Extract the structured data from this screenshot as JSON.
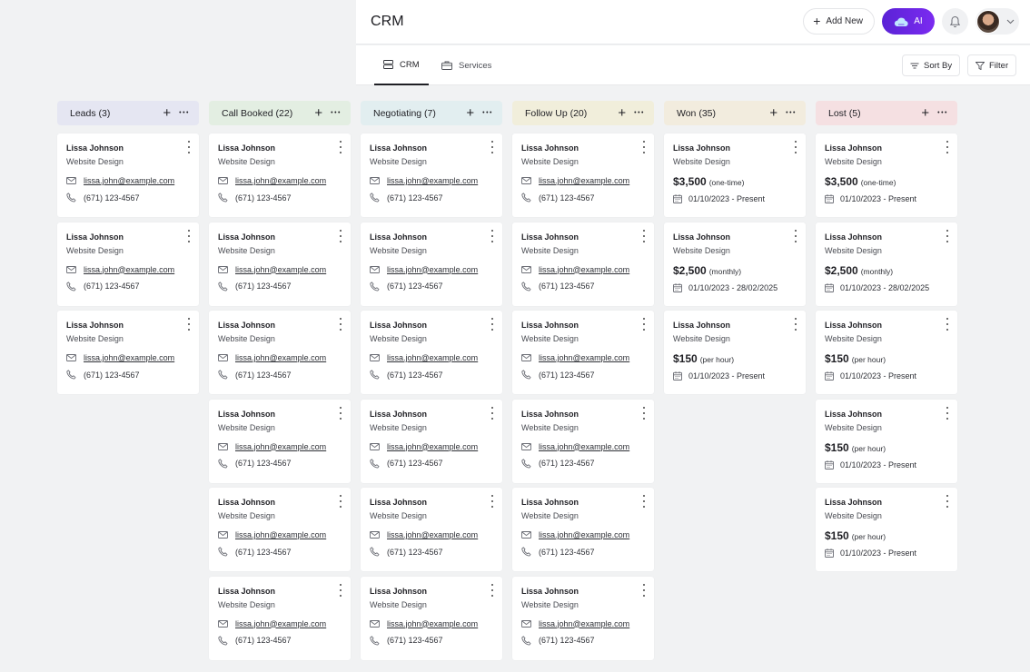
{
  "header": {
    "title": "CRM",
    "add_new_label": "Add New",
    "ai_label": "AI"
  },
  "tabs": [
    {
      "label": "CRM",
      "active": true,
      "icon": "stack-icon"
    },
    {
      "label": "Services",
      "active": false,
      "icon": "briefcase-icon"
    }
  ],
  "toolbar": {
    "sort_label": "Sort By",
    "filter_label": "Filter"
  },
  "colors": {
    "leads": "#e5e6f2",
    "call_booked": "#e3eee2",
    "negotiating": "#e2eef0",
    "follow_up": "#f1eedb",
    "won": "#f2ecde",
    "lost": "#f5e0e2",
    "ai_button": "#6a27e6"
  },
  "columns": [
    {
      "key": "leads",
      "title": "Leads (3)",
      "cards": [
        {
          "name": "Lissa Johnson",
          "service": "Website Design",
          "email": "lissa.john@example.com",
          "phone": "(671) 123-4567"
        },
        {
          "name": "Lissa Johnson",
          "service": "Website Design",
          "email": "lissa.john@example.com",
          "phone": "(671) 123-4567"
        },
        {
          "name": "Lissa Johnson",
          "service": "Website Design",
          "email": "lissa.john@example.com",
          "phone": "(671) 123-4567"
        }
      ]
    },
    {
      "key": "call_booked",
      "title": "Call Booked (22)",
      "cards": [
        {
          "name": "Lissa Johnson",
          "service": "Website Design",
          "email": "lissa.john@example.com",
          "phone": "(671) 123-4567"
        },
        {
          "name": "Lissa Johnson",
          "service": "Website Design",
          "email": "lissa.john@example.com",
          "phone": "(671) 123-4567"
        },
        {
          "name": "Lissa Johnson",
          "service": "Website Design",
          "email": "lissa.john@example.com",
          "phone": "(671) 123-4567"
        },
        {
          "name": "Lissa Johnson",
          "service": "Website Design",
          "email": "lissa.john@example.com",
          "phone": "(671) 123-4567"
        },
        {
          "name": "Lissa Johnson",
          "service": "Website Design",
          "email": "lissa.john@example.com",
          "phone": "(671) 123-4567"
        },
        {
          "name": "Lissa Johnson",
          "service": "Website Design",
          "email": "lissa.john@example.com",
          "phone": "(671) 123-4567"
        }
      ]
    },
    {
      "key": "negotiating",
      "title": "Negotiating (7)",
      "cards": [
        {
          "name": "Lissa Johnson",
          "service": "Website Design",
          "email": "lissa.john@example.com",
          "phone": "(671) 123-4567"
        },
        {
          "name": "Lissa Johnson",
          "service": "Website Design",
          "email": "lissa.john@example.com",
          "phone": "(671) 123-4567"
        },
        {
          "name": "Lissa Johnson",
          "service": "Website Design",
          "email": "lissa.john@example.com",
          "phone": "(671) 123-4567"
        },
        {
          "name": "Lissa Johnson",
          "service": "Website Design",
          "email": "lissa.john@example.com",
          "phone": "(671) 123-4567"
        },
        {
          "name": "Lissa Johnson",
          "service": "Website Design",
          "email": "lissa.john@example.com",
          "phone": "(671) 123-4567"
        },
        {
          "name": "Lissa Johnson",
          "service": "Website Design",
          "email": "lissa.john@example.com",
          "phone": "(671) 123-4567"
        }
      ]
    },
    {
      "key": "follow_up",
      "title": "Follow Up (20)",
      "cards": [
        {
          "name": "Lissa Johnson",
          "service": "Website Design",
          "email": "lissa.john@example.com",
          "phone": "(671) 123-4567"
        },
        {
          "name": "Lissa Johnson",
          "service": "Website Design",
          "email": "lissa.john@example.com",
          "phone": "(671) 123-4567"
        },
        {
          "name": "Lissa Johnson",
          "service": "Website Design",
          "email": "lissa.john@example.com",
          "phone": "(671) 123-4567"
        },
        {
          "name": "Lissa Johnson",
          "service": "Website Design",
          "email": "lissa.john@example.com",
          "phone": "(671) 123-4567"
        },
        {
          "name": "Lissa Johnson",
          "service": "Website Design",
          "email": "lissa.john@example.com",
          "phone": "(671) 123-4567"
        },
        {
          "name": "Lissa Johnson",
          "service": "Website Design",
          "email": "lissa.john@example.com",
          "phone": "(671) 123-4567"
        }
      ]
    },
    {
      "key": "won",
      "title": "Won (35)",
      "cards": [
        {
          "name": "Lissa Johnson",
          "service": "Website Design",
          "price": "$3,500",
          "price_unit": "(one-time)",
          "dates": "01/10/2023 - Present"
        },
        {
          "name": "Lissa Johnson",
          "service": "Website Design",
          "price": "$2,500",
          "price_unit": "(monthly)",
          "dates": "01/10/2023 - 28/02/2025"
        },
        {
          "name": "Lissa Johnson",
          "service": "Website Design",
          "price": "$150",
          "price_unit": "(per hour)",
          "dates": "01/10/2023 - Present"
        }
      ]
    },
    {
      "key": "lost",
      "title": "Lost (5)",
      "cards": [
        {
          "name": "Lissa Johnson",
          "service": "Website Design",
          "price": "$3,500",
          "price_unit": "(one-time)",
          "dates": "01/10/2023 - Present"
        },
        {
          "name": "Lissa Johnson",
          "service": "Website Design",
          "price": "$2,500",
          "price_unit": "(monthly)",
          "dates": "01/10/2023 - 28/02/2025"
        },
        {
          "name": "Lissa Johnson",
          "service": "Website Design",
          "price": "$150",
          "price_unit": "(per hour)",
          "dates": "01/10/2023 - Present"
        },
        {
          "name": "Lissa Johnson",
          "service": "Website Design",
          "price": "$150",
          "price_unit": "(per hour)",
          "dates": "01/10/2023 - Present"
        },
        {
          "name": "Lissa Johnson",
          "service": "Website Design",
          "price": "$150",
          "price_unit": "(per hour)",
          "dates": "01/10/2023 - Present"
        }
      ]
    }
  ]
}
